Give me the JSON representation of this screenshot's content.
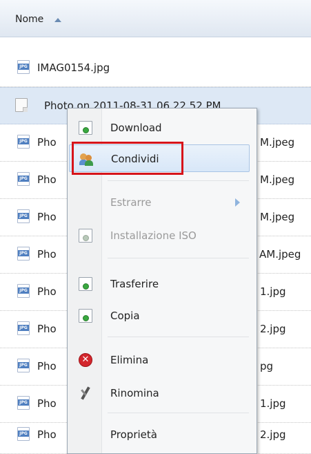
{
  "header": {
    "column_label": "Nome"
  },
  "files": [
    {
      "name": "IMAG0154.jpg",
      "type": "JPG"
    },
    {
      "name": "Photo on 2011-08-31 06.22.52 PM",
      "type": "blank",
      "selected": true
    },
    {
      "name": "Pho",
      "right": "M.jpeg",
      "type": "JPG"
    },
    {
      "name": "Pho",
      "right": "M.jpeg",
      "type": "JPG"
    },
    {
      "name": "Pho",
      "right": "M.jpeg",
      "type": "JPG"
    },
    {
      "name": "Pho",
      "right": "AM.jpeg",
      "type": "JPG"
    },
    {
      "name": "Pho",
      "right": "1.jpg",
      "type": "JPG"
    },
    {
      "name": "Pho",
      "right": "2.jpg",
      "type": "JPG"
    },
    {
      "name": "Pho",
      "right": "pg",
      "type": "JPG"
    },
    {
      "name": "Pho",
      "right": "1.jpg",
      "type": "JPG"
    },
    {
      "name": "Pho",
      "right": "2.jpg",
      "type": "JPG"
    }
  ],
  "context_menu": {
    "items": [
      {
        "label": "Download",
        "icon": "download-icon",
        "enabled": true
      },
      {
        "label": "Condividi",
        "icon": "share-users-icon",
        "enabled": true,
        "hovered": true
      },
      {
        "label": "Estrarre",
        "icon": "none",
        "enabled": false,
        "submenu": true
      },
      {
        "label": "Installazione ISO",
        "icon": "install-iso-icon",
        "enabled": false
      },
      {
        "label": "Trasferire",
        "icon": "transfer-icon",
        "enabled": true
      },
      {
        "label": "Copia",
        "icon": "copy-icon",
        "enabled": true
      },
      {
        "label": "Elimina",
        "icon": "delete-icon",
        "enabled": true
      },
      {
        "label": "Rinomina",
        "icon": "rename-icon",
        "enabled": true
      },
      {
        "label": "Proprietà",
        "icon": "none",
        "enabled": true
      }
    ]
  },
  "colors": {
    "highlight_border": "#d7141a",
    "selected_row": "#dde8f5",
    "header_bg": "#dfe7f1"
  }
}
